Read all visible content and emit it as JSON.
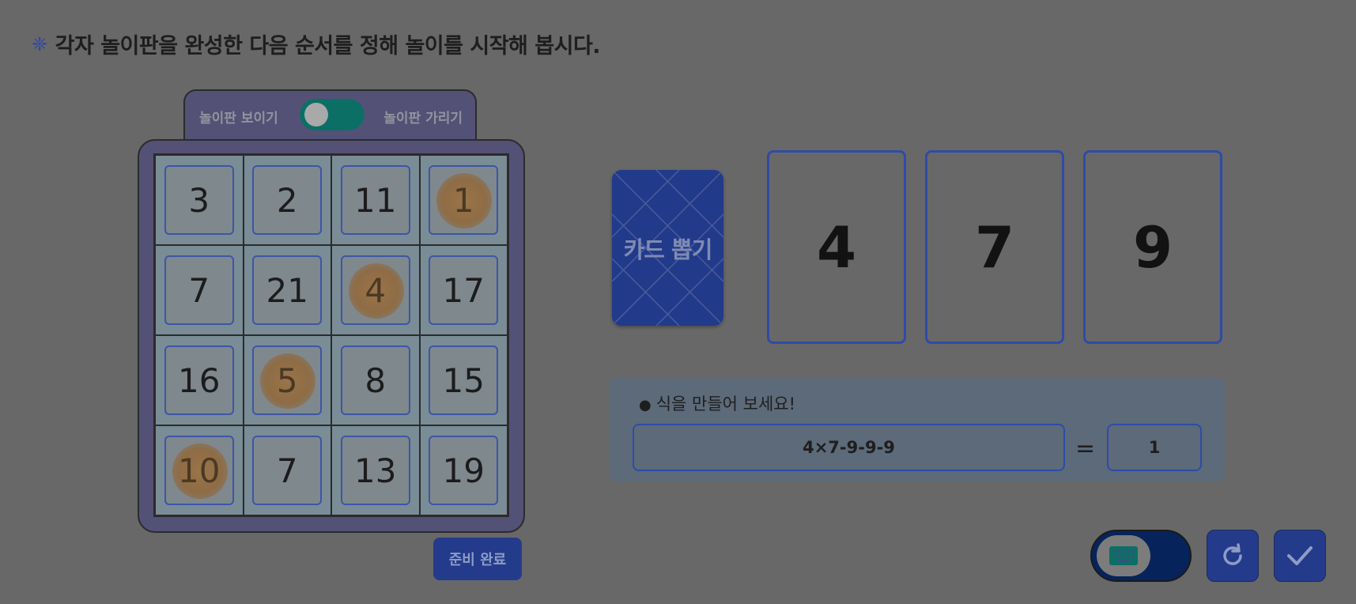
{
  "instruction": {
    "bullet": "❈",
    "text": "각자 놀이판을 완성한 다음 순서를 정해 놀이를 시작해 봅시다."
  },
  "board_toggle": {
    "show_label": "놀이판 보이기",
    "hide_label": "놀이판 가리기"
  },
  "board": {
    "rows": [
      [
        {
          "n": "3",
          "marked": false
        },
        {
          "n": "2",
          "marked": false
        },
        {
          "n": "11",
          "marked": false
        },
        {
          "n": "1",
          "marked": true
        }
      ],
      [
        {
          "n": "7",
          "marked": false
        },
        {
          "n": "21",
          "marked": false
        },
        {
          "n": "4",
          "marked": true
        },
        {
          "n": "17",
          "marked": false
        }
      ],
      [
        {
          "n": "16",
          "marked": false
        },
        {
          "n": "5",
          "marked": true
        },
        {
          "n": "8",
          "marked": false
        },
        {
          "n": "15",
          "marked": false
        }
      ],
      [
        {
          "n": "10",
          "marked": true
        },
        {
          "n": "7",
          "marked": false
        },
        {
          "n": "13",
          "marked": false
        },
        {
          "n": "19",
          "marked": false
        }
      ]
    ]
  },
  "ready_button": "준비 완료",
  "draw_card_label": "카드 뽑기",
  "cards": [
    "4",
    "7",
    "9"
  ],
  "expression": {
    "prompt": "식을 만들어 보세요!",
    "value": "4×7-9-9-9",
    "equals": "=",
    "result": "1"
  },
  "icons": {
    "keyboard": "keyboard-icon",
    "reset": "refresh-icon",
    "check": "check-icon"
  }
}
